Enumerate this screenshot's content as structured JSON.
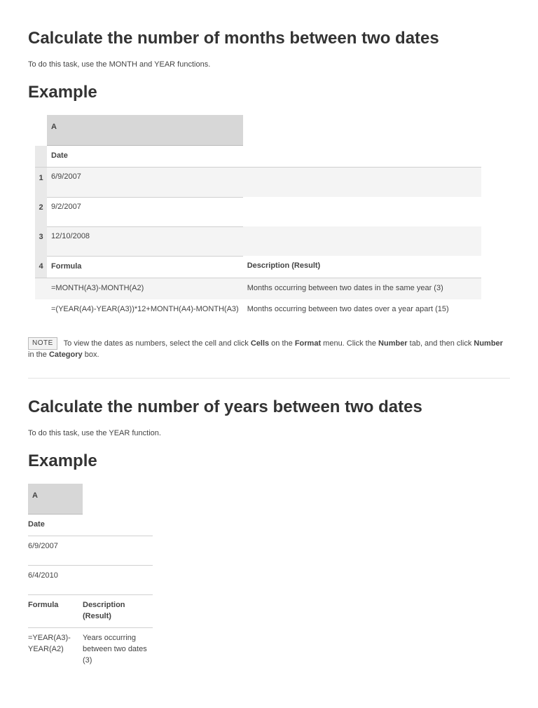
{
  "section1": {
    "heading": "Calculate the number of months between two dates",
    "intro": "To do this task, use the MONTH and YEAR functions.",
    "exampleHeading": "Example",
    "colHeader": "A",
    "dateLabel": "Date",
    "rows": {
      "1": "6/9/2007",
      "2": "9/2/2007",
      "3": "12/10/2008"
    },
    "rowNums": {
      "1": "1",
      "2": "2",
      "3": "3",
      "4": "4"
    },
    "formulaLabel": "Formula",
    "descLabel": "Description (Result)",
    "formulas": [
      {
        "f": "=MONTH(A3)-MONTH(A2)",
        "d": "Months occurring between two dates in the same year (3)"
      },
      {
        "f": "=(YEAR(A4)-YEAR(A3))*12+MONTH(A4)-MONTH(A3)",
        "d": "Months occurring between two dates over a year apart (15)"
      }
    ]
  },
  "note": {
    "badge": "NOTE",
    "pre": "To view the dates as numbers, select the cell and click ",
    "b1": "Cells",
    "mid1": " on the ",
    "b2": "Format",
    "mid2": " menu. Click the ",
    "b3": "Number",
    "mid3": " tab, and then click ",
    "b4": "Number",
    "mid4": " in the ",
    "b5": "Category",
    "post": " box."
  },
  "section2": {
    "heading": "Calculate the number of years between two dates",
    "intro": "To do this task, use the YEAR function.",
    "exampleHeading": "Example",
    "colHeader": "A",
    "dateLabel": "Date",
    "rows": {
      "1": "6/9/2007",
      "2": "6/4/2010"
    },
    "formulaLabel": "Formula",
    "descLabel": "Description (Result)",
    "formulas": [
      {
        "f": "=YEAR(A3)-YEAR(A2)",
        "d": "Years occurring between two dates (3)"
      }
    ]
  }
}
